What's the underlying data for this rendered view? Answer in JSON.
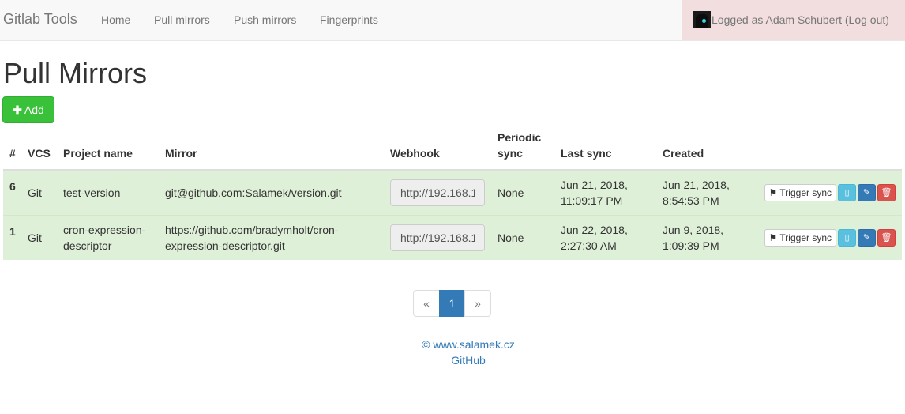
{
  "navbar": {
    "brand": "Gitlab Tools",
    "links": [
      "Home",
      "Pull mirrors",
      "Push mirrors",
      "Fingerprints"
    ],
    "user_text": "Logged as Adam Schubert (Log out)"
  },
  "page_title": "Pull Mirrors",
  "add_button": {
    "icon": "plus-icon",
    "label": "Add"
  },
  "table": {
    "headers": {
      "num": "#",
      "vcs": "VCS",
      "project": "Project name",
      "mirror": "Mirror",
      "webhook": "Webhook",
      "periodic": "Periodic sync",
      "last_sync": "Last sync",
      "created": "Created"
    },
    "rows": [
      {
        "num": "6",
        "vcs": "Git",
        "project": "test-version",
        "mirror": "git@github.com:Salamek/version.git",
        "webhook": "http://192.168.1",
        "periodic": "None",
        "last_sync": "Jun 21, 2018, 11:09:17 PM",
        "created": "Jun 21, 2018, 8:54:53 PM"
      },
      {
        "num": "1",
        "vcs": "Git",
        "project": "cron-expression-descriptor",
        "mirror": "https://github.com/bradymholt/cron-expression-descriptor.git",
        "webhook": "http://192.168.1",
        "periodic": "None",
        "last_sync": "Jun 22, 2018, 2:27:30 AM",
        "created": "Jun 9, 2018, 1:09:39 PM"
      }
    ],
    "actions": {
      "trigger_label": "Trigger sync",
      "trigger_icon": "signpost-icon",
      "log_icon": "file-icon",
      "edit_icon": "pencil-icon",
      "delete_icon": "trash-icon"
    }
  },
  "pagination": {
    "prev": "«",
    "current": "1",
    "next": "»"
  },
  "footer": {
    "copyright_link": "© www.salamek.cz",
    "github_link": "GitHub"
  },
  "colors": {
    "success_row": "#dff0d8",
    "add_button": "#3ac13a",
    "user_box": "#f2dede",
    "primary": "#337ab7",
    "info": "#5bc0de",
    "danger": "#d9534f"
  }
}
